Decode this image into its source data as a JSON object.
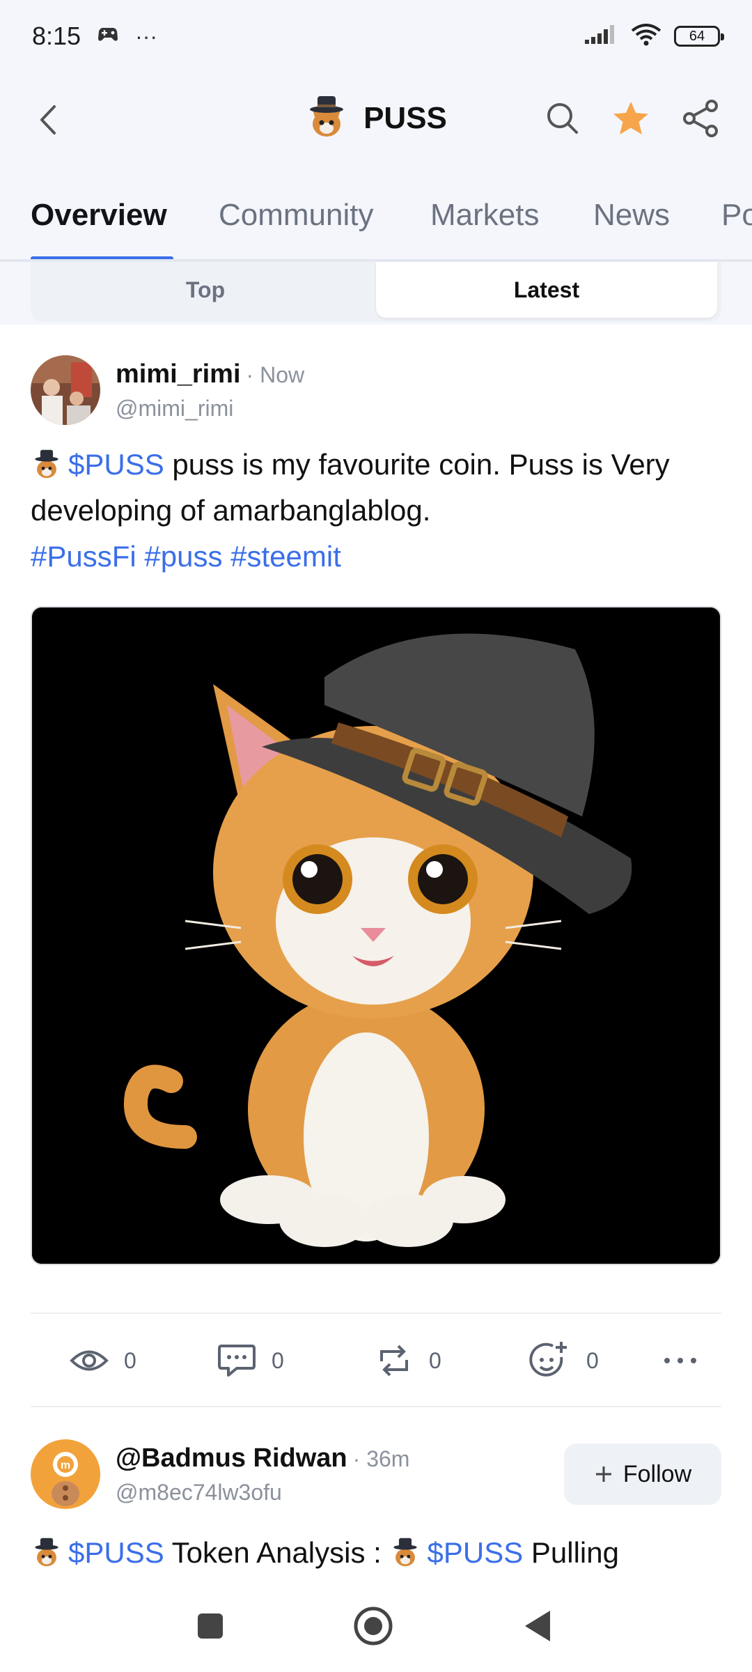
{
  "status_bar": {
    "time": "8:15",
    "more": "···",
    "battery": "64"
  },
  "header": {
    "title": "PUSS",
    "icons": [
      "back-arrow-icon",
      "puss-logo-icon",
      "search-icon",
      "star-icon",
      "share-icon"
    ],
    "star_color": "#f7a44a"
  },
  "tabs": [
    "Overview",
    "Community",
    "Markets",
    "News",
    "Po"
  ],
  "active_tab": "Overview",
  "subtabs": [
    "Top",
    "Latest"
  ],
  "active_subtab": "Latest",
  "posts": [
    {
      "name": "mimi_rimi",
      "time": "· Now",
      "handle": "@mimi_rimi",
      "cashtag": "$PUSS",
      "text1": " puss is my favourite coin. Puss is Very developing of amarbanglablog.",
      "hashtags": "#PussFi #puss #steemit",
      "actions": {
        "views": "0",
        "comments": "0",
        "reposts": "0",
        "reactions": "0"
      }
    },
    {
      "name": "@Badmus Ridwan",
      "time": "· 36m",
      "handle": "@m8ec74lw3ofu",
      "follow_label": "Follow",
      "cashtag1": "$PUSS",
      "text_mid": " Token Analysis : ",
      "cashtag2": "$PUSS",
      "text_end": " Pulling"
    }
  ],
  "colors": {
    "accent": "#3b6fe8",
    "header_bg": "#f4f6fb"
  }
}
